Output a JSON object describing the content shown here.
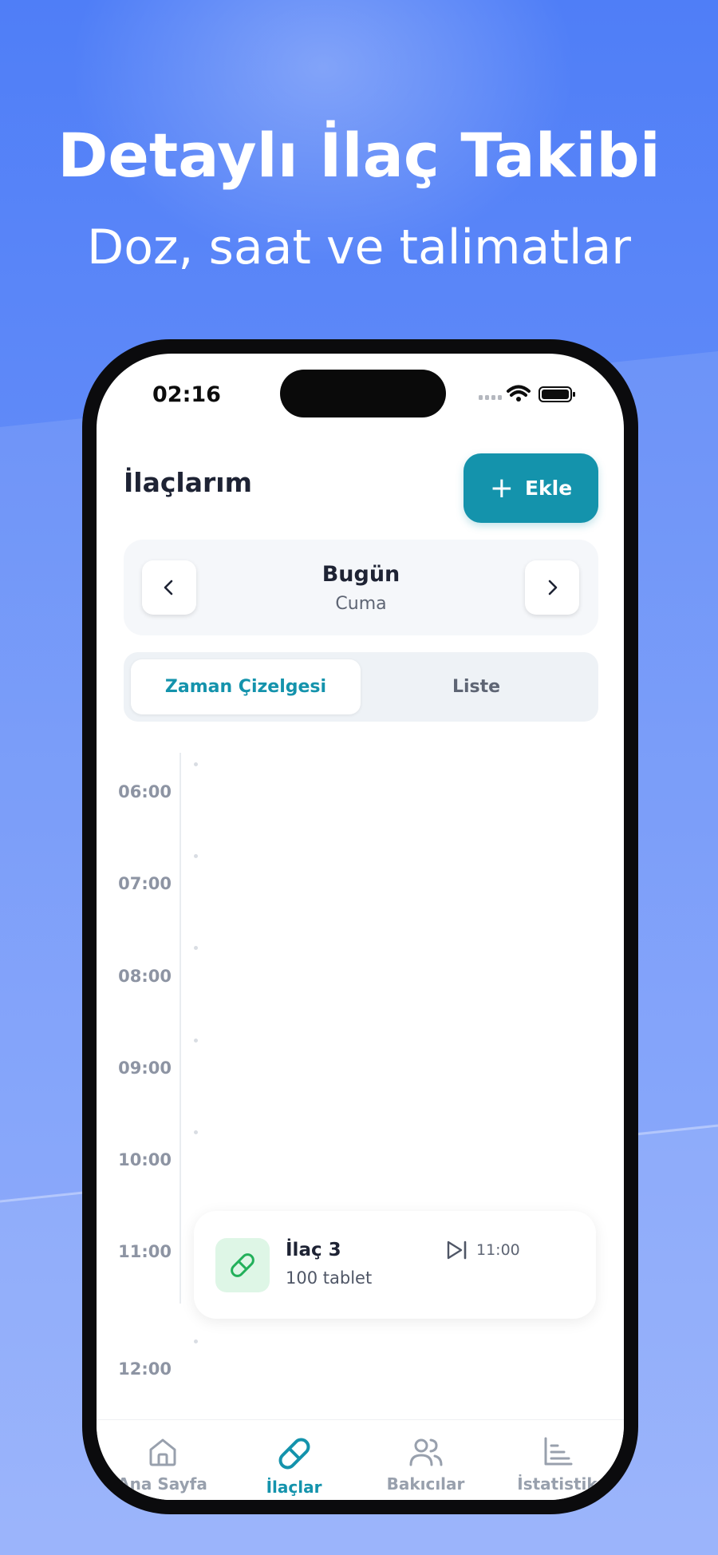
{
  "promo": {
    "title": "Detaylı İlaç Takibi",
    "subtitle": "Doz, saat ve talimatlar"
  },
  "colors": {
    "accent": "#1493ac",
    "background_top": "#4f7ef7",
    "background_bottom": "#8aa8fb",
    "pill_green": "#22b05a"
  },
  "status_bar": {
    "time": "02:16",
    "icons": [
      "cellular-signal-icon",
      "wifi-icon",
      "battery-icon"
    ]
  },
  "header": {
    "title": "İlaçlarım",
    "add_label": "Ekle",
    "add_icon": "plus-icon"
  },
  "date_nav": {
    "title": "Bugün",
    "subtitle": "Cuma",
    "prev_icon": "chevron-left-icon",
    "next_icon": "chevron-right-icon"
  },
  "view_tabs": [
    {
      "label": "Zaman Çizelgesi",
      "active": true
    },
    {
      "label": "Liste",
      "active": false
    }
  ],
  "timeline": {
    "hours": [
      "06:00",
      "07:00",
      "08:00",
      "09:00",
      "10:00",
      "11:00",
      "12:00"
    ]
  },
  "medication": {
    "name": "İlaç 3",
    "dose": "100 tablet",
    "time": "11:00",
    "icon": "pill-icon",
    "time_icon": "play-next-icon"
  },
  "tab_bar": [
    {
      "label": "Ana Sayfa",
      "icon": "home-icon",
      "active": false
    },
    {
      "label": "İlaçlar",
      "icon": "pill-icon",
      "active": true
    },
    {
      "label": "Bakıcılar",
      "icon": "users-icon",
      "active": false
    },
    {
      "label": "İstatistik",
      "icon": "bar-chart-icon",
      "active": false
    }
  ]
}
